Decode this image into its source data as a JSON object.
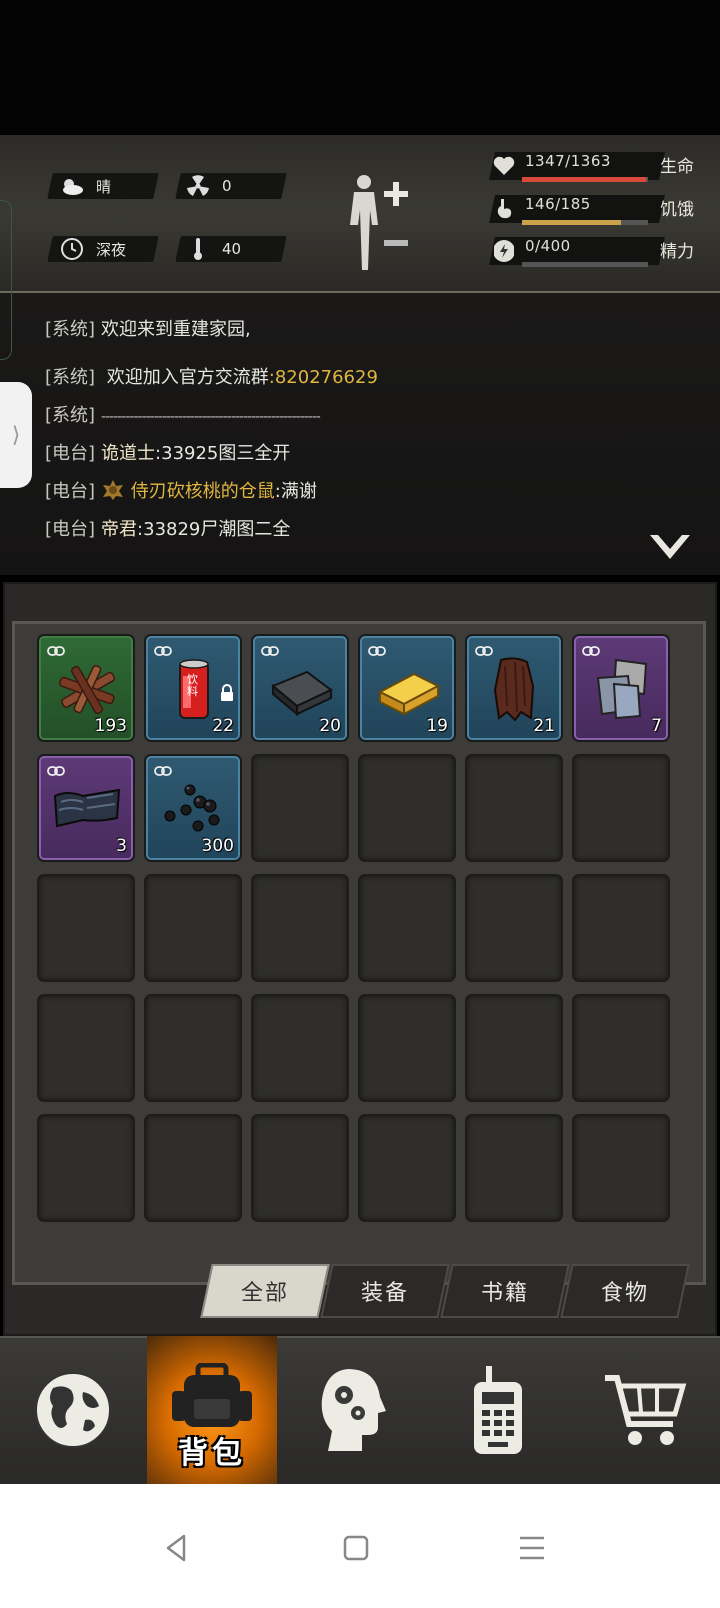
{
  "status": {
    "weather": "晴",
    "radiation": "0",
    "time_of_day": "深夜",
    "temperature": "40"
  },
  "vitals": [
    {
      "value": "1347/1363",
      "label": "生命",
      "fraction": 0.988,
      "color": "#d94a3a",
      "icon": "heart-icon"
    },
    {
      "value": "146/185",
      "label": "饥饿",
      "fraction": 0.789,
      "color": "#c9a24a",
      "icon": "stomach-icon"
    },
    {
      "value": "0/400",
      "label": "精力",
      "fraction": 0.0,
      "color": "#8aa",
      "icon": "energy-icon"
    }
  ],
  "chat": [
    {
      "tag": "[系统]",
      "text": "欢迎来到重建家园,",
      "extra": ""
    },
    {
      "tag": "[系统]",
      "text": " 欢迎加入官方交流群",
      "extra": ":820276629"
    },
    {
      "tag": "[系统]",
      "text": "------------------------------------------------------",
      "extra": ""
    },
    {
      "tag": "[电台]",
      "text": "诡道士",
      "extra": ":33925图三全开"
    },
    {
      "tag": "[电台]",
      "text": " 侍刃砍核桃的仓鼠",
      "extra": ":满谢"
    },
    {
      "tag": "[电台]",
      "text": "帝君",
      "extra": ":33829尸潮图二全"
    }
  ],
  "inventory": [
    {
      "name": "wood",
      "rarity": "green",
      "count": "193",
      "locked": false
    },
    {
      "name": "soda-can",
      "rarity": "blue",
      "count": "22",
      "locked": true,
      "can_text": "饮料"
    },
    {
      "name": "iron-bar",
      "rarity": "blue",
      "count": "20",
      "locked": false
    },
    {
      "name": "gold-bar",
      "rarity": "blue",
      "count": "19",
      "locked": false
    },
    {
      "name": "leather",
      "rarity": "blue",
      "count": "21",
      "locked": false
    },
    {
      "name": "cloth",
      "rarity": "purple",
      "count": "7",
      "locked": false
    },
    {
      "name": "dark-cloth",
      "rarity": "purple",
      "count": "3",
      "locked": false
    },
    {
      "name": "coal-pellets",
      "rarity": "blue",
      "count": "300",
      "locked": false
    }
  ],
  "tabs": [
    "全部",
    "装备",
    "书籍",
    "食物"
  ],
  "active_tab": "全部",
  "nav": {
    "active_label": "背包",
    "items": [
      "globe-icon",
      "backpack-icon",
      "head-gears-icon",
      "walkie-talkie-icon",
      "cart-icon"
    ]
  }
}
